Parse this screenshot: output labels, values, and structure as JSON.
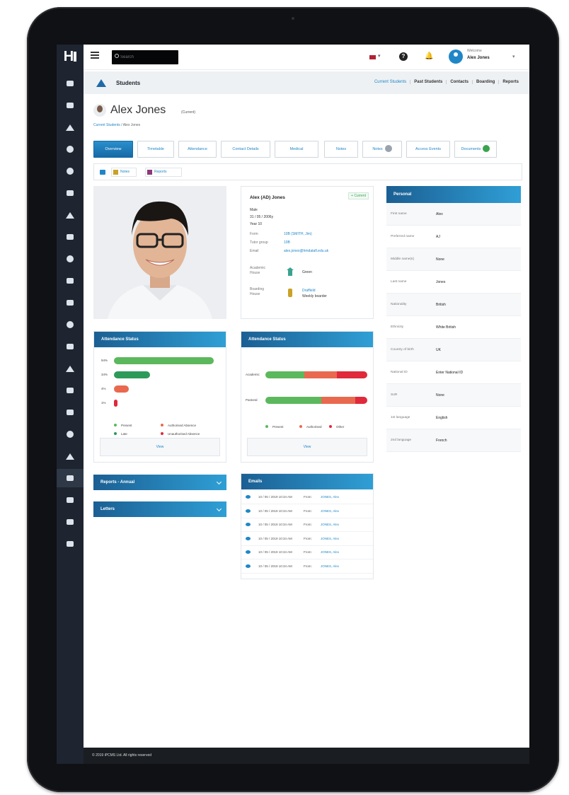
{
  "topbar": {
    "search_placeholder": "Search",
    "welcome_label": "Welcome",
    "user_name": "Alex Jones"
  },
  "sidebar": {
    "icons": [
      "dashboard-icon",
      "cloud-icon",
      "person-icon",
      "group-icon",
      "chart-icon",
      "chat-icon",
      "person-icon",
      "document-icon",
      "cloud-icon",
      "calendar-icon",
      "document-icon",
      "chat-icon",
      "id-card-icon",
      "plus-icon",
      "tag-icon",
      "document-icon",
      "pin-icon",
      "person-icon",
      "mail-icon",
      "book-icon",
      "code-icon",
      "wrench-icon"
    ]
  },
  "subheader": {
    "section_title": "Students",
    "nav": [
      "Current Students",
      "Past Students",
      "Contacts",
      "Boarding",
      "Reports"
    ]
  },
  "profile": {
    "name": "Alex Jones",
    "status": "(Current)",
    "breadcrumb_link": "Current Students",
    "breadcrumb_current": "Alex Jones"
  },
  "tabs": [
    "Overview",
    "Timetable",
    "Attendance",
    "Contact Details",
    "Medical",
    "Notes",
    "Notes",
    "Access Events",
    "Documents"
  ],
  "subtabs": [
    "Notes",
    "Reports"
  ],
  "info_card": {
    "name": "Alex (AD) Jones",
    "badge": "+ Current",
    "gender": "Male",
    "dob": "31 / 05 / 2006y",
    "year": "Year 10",
    "form_label": "Form",
    "form_value": "10B (SMITH, Jim)",
    "tutor_label": "Tutor group",
    "tutor_value": "10B",
    "email_label": "Email",
    "email_value": "alex.jones@hmdatafl.edu.uk",
    "academic_label": "Academic House",
    "academic_value": "Green",
    "boarding_label": "Boarding House",
    "boarding_value_1": "Draffield",
    "boarding_value_2": "Weekly boarder"
  },
  "personal": {
    "title": "Personal",
    "rows": [
      {
        "label": "First name",
        "value": "Alex"
      },
      {
        "label": "Preferred name",
        "value": "AJ"
      },
      {
        "label": "Middle name(s)",
        "value": "None"
      },
      {
        "label": "Last name",
        "value": "Jones"
      },
      {
        "label": "Nationality",
        "value": "British"
      },
      {
        "label": "Ethnicity",
        "value": "White British"
      },
      {
        "label": "Country of birth",
        "value": "UK"
      },
      {
        "label": "National ID",
        "value": "Enter National ID"
      },
      {
        "label": "SoR",
        "value": "None"
      },
      {
        "label": "1st language",
        "value": "English"
      },
      {
        "label": "2nd language",
        "value": "French"
      }
    ]
  },
  "attendance_left": {
    "title": "Attendance Status",
    "bars": [
      {
        "label": "94%",
        "value": 94,
        "color": "#5cb85c"
      },
      {
        "label": "34%",
        "value": 34,
        "color": "#2e9a59"
      },
      {
        "label": "4%",
        "value": 14,
        "color": "#e9694f"
      },
      {
        "label": "1%",
        "value": 2,
        "color": "#e0293a"
      }
    ],
    "legend": [
      "Present",
      "Authorised Absence",
      "Late",
      "Unauthorised Absence"
    ],
    "button": "View"
  },
  "attendance_right": {
    "title": "Attendance Status",
    "rows": [
      {
        "label": "Academic",
        "present": 38,
        "authorised": 32,
        "unauthorised": 30
      },
      {
        "label": "Pastoral",
        "present": 55,
        "authorised": 33,
        "unauthorised": 12
      }
    ],
    "legend": [
      "Present",
      "Authorised",
      "Other"
    ],
    "button": "View"
  },
  "collapsibles": [
    "Reports - Annual",
    "Letters"
  ],
  "emails": {
    "title": "Emails",
    "rows": [
      {
        "date": "10 / 05 / 2019 10:34 AM",
        "from": "From:",
        "subject": "JONES, Alex"
      },
      {
        "date": "10 / 05 / 2019 10:34 AM",
        "from": "From:",
        "subject": "JONES, Alex"
      },
      {
        "date": "10 / 05 / 2019 10:34 AM",
        "from": "From:",
        "subject": "JONES, Alex"
      },
      {
        "date": "10 / 05 / 2019 10:34 AM",
        "from": "From:",
        "subject": "JONES, Alex"
      },
      {
        "date": "10 / 05 / 2019 10:34 AM",
        "from": "From:",
        "subject": "JONES, Alex"
      },
      {
        "date": "10 / 05 / 2019 10:34 AM",
        "from": "From:",
        "subject": "JONES, Alex"
      }
    ]
  },
  "footer": {
    "text": "© 2019 iPCMS Ltd. All rights reserved"
  },
  "colors": {
    "accent": "#1f87c7",
    "sidebar": "#1e2530",
    "present": "#5cb85c",
    "authorised": "#e9694f",
    "unauthorised": "#e0293a"
  }
}
